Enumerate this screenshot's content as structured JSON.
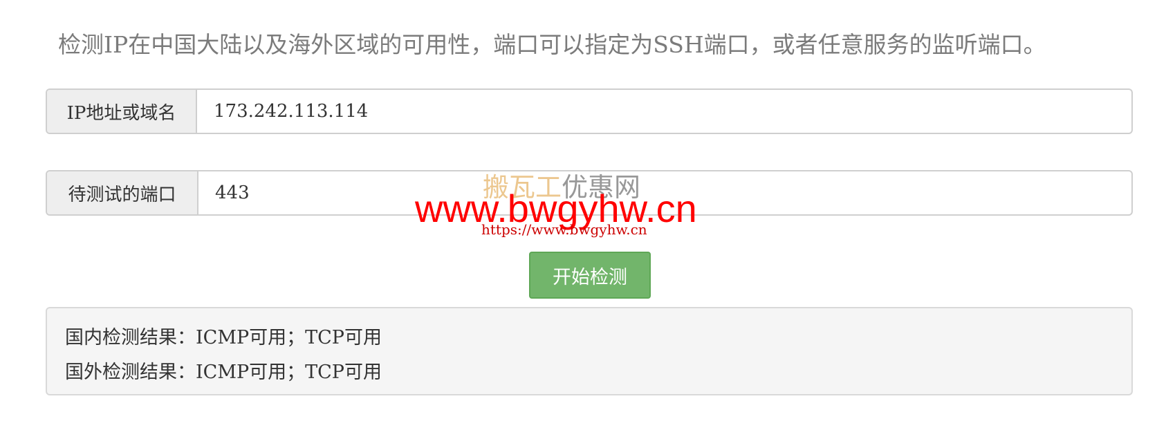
{
  "headline": "检测IP在中国大陆以及海外区域的可用性，端口可以指定为SSH端口，或者任意服务的监听端口。",
  "form": {
    "ip": {
      "label": "IP地址或域名",
      "value": "173.242.113.114"
    },
    "port": {
      "label": "待测试的端口",
      "value": "443"
    },
    "submit_label": "开始检测"
  },
  "results": {
    "domestic": "国内检测结果：ICMP可用；TCP可用",
    "overseas": "国外检测结果：ICMP可用；TCP可用"
  },
  "watermark": {
    "brand_part1": "搬瓦工",
    "brand_part2": "优惠网",
    "main": "www.bwgyhw.cn",
    "sub": "https://www.bwgyhw.cn"
  }
}
